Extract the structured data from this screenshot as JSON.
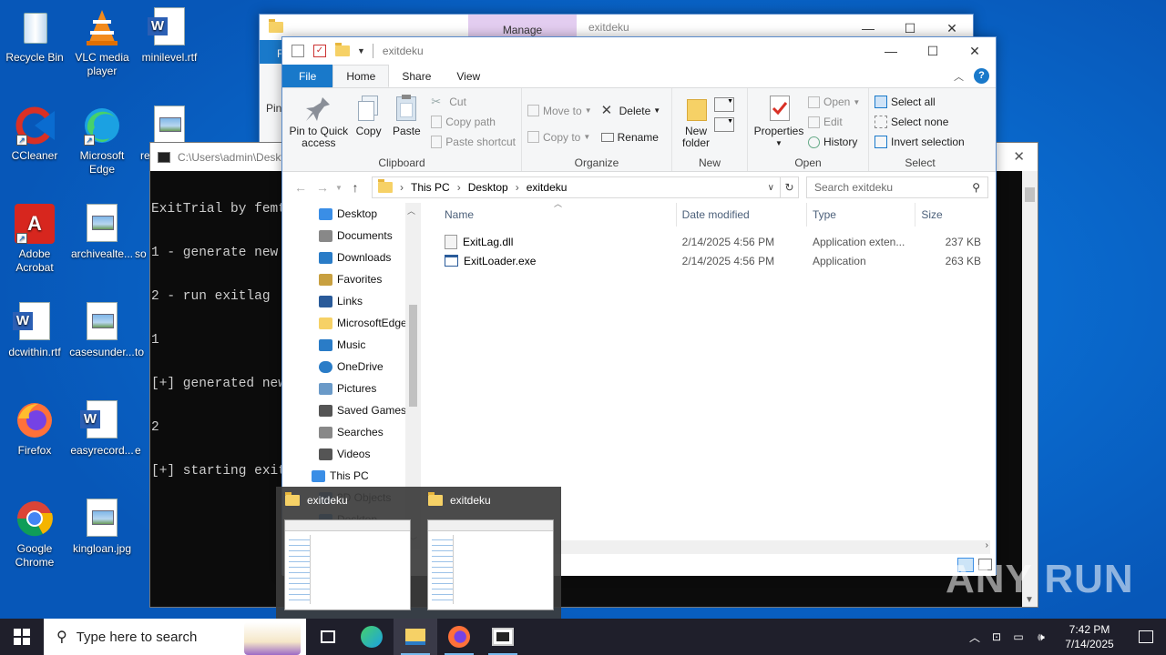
{
  "desktop": {
    "icons": [
      {
        "label": "Recycle Bin"
      },
      {
        "label": "VLC media player"
      },
      {
        "label": "minilevel.rtf"
      },
      {
        "label": "CCleaner"
      },
      {
        "label": "Microsoft Edge"
      },
      {
        "label": "re"
      },
      {
        "label": "Adobe Acrobat"
      },
      {
        "label": "archivealte..."
      },
      {
        "label": "so"
      },
      {
        "label": "dcwithin.rtf"
      },
      {
        "label": "casesunder..."
      },
      {
        "label": "to"
      },
      {
        "label": "Firefox"
      },
      {
        "label": "easyrecord..."
      },
      {
        "label": "e"
      },
      {
        "label": "Google Chrome"
      },
      {
        "label": "kingloan.jpg"
      }
    ]
  },
  "back_window": {
    "manage_tab": "Manage",
    "title": "exitdeku",
    "file_initial": "F",
    "pin_partial": "Pin"
  },
  "console": {
    "title": "C:\\Users\\admin\\Deskt",
    "lines": [
      "ExitTrial by femto",
      "1 - generate new se",
      "2 - run exitlag",
      "1",
      "[+] generated new s",
      "2",
      "[+] starting exitla"
    ]
  },
  "explorer": {
    "title": "exitdeku",
    "tabs": {
      "file": "File",
      "home": "Home",
      "share": "Share",
      "view": "View"
    },
    "clipboard": {
      "pin": "Pin to Quick access",
      "copy": "Copy",
      "paste": "Paste",
      "cut": "Cut",
      "copy_path": "Copy path",
      "paste_shortcut": "Paste shortcut",
      "group": "Clipboard"
    },
    "organize": {
      "move_to": "Move to",
      "copy_to": "Copy to",
      "delete": "Delete",
      "rename": "Rename",
      "group": "Organize"
    },
    "new": {
      "new_folder": "New folder",
      "group": "New"
    },
    "open": {
      "properties": "Properties",
      "open": "Open",
      "edit": "Edit",
      "history": "History",
      "group": "Open"
    },
    "select": {
      "select_all": "Select all",
      "select_none": "Select none",
      "invert": "Invert selection",
      "group": "Select"
    },
    "breadcrumb": [
      "This PC",
      "Desktop",
      "exitdeku"
    ],
    "search_placeholder": "Search exitdeku",
    "nav": [
      {
        "label": "Desktop",
        "icon": "desktop-icon"
      },
      {
        "label": "Documents",
        "icon": "documents-icon"
      },
      {
        "label": "Downloads",
        "icon": "downloads-icon"
      },
      {
        "label": "Favorites",
        "icon": "star-icon"
      },
      {
        "label": "Links",
        "icon": "links-icon"
      },
      {
        "label": "MicrosoftEdge",
        "icon": "folder-icon"
      },
      {
        "label": "Music",
        "icon": "music-icon"
      },
      {
        "label": "OneDrive",
        "icon": "cloud-icon"
      },
      {
        "label": "Pictures",
        "icon": "pictures-icon"
      },
      {
        "label": "Saved Games",
        "icon": "games-icon"
      },
      {
        "label": "Searches",
        "icon": "search-icon"
      },
      {
        "label": "Videos",
        "icon": "videos-icon"
      },
      {
        "label": "This PC",
        "icon": "pc-icon"
      },
      {
        "label": "3D Objects",
        "icon": "3d-icon"
      },
      {
        "label": "Desktop",
        "icon": "desktop-icon"
      }
    ],
    "columns": {
      "name": "Name",
      "date": "Date modified",
      "type": "Type",
      "size": "Size"
    },
    "files": [
      {
        "name": "ExitLag.dll",
        "date": "2/14/2025 4:56 PM",
        "type": "Application exten...",
        "size": "237 KB"
      },
      {
        "name": "ExitLoader.exe",
        "date": "2/14/2025 4:56 PM",
        "type": "Application",
        "size": "263 KB"
      }
    ]
  },
  "thumbnails": [
    {
      "title": "exitdeku"
    },
    {
      "title": "exitdeku"
    }
  ],
  "taskbar": {
    "search_placeholder": "Type here to search",
    "time": "7:42 PM",
    "date": "7/14/2025"
  },
  "watermark": "ANY RUN",
  "colors": {
    "accent": "#1979ca",
    "taskbar": "#1f1f2b",
    "desktop": "#0a6cd0"
  }
}
